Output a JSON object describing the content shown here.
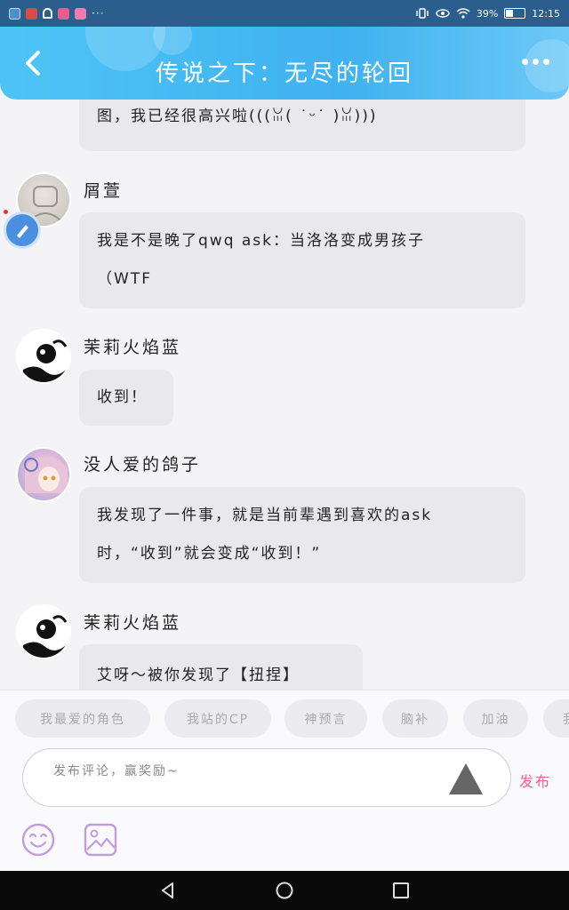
{
  "status_bar": {
    "battery_text": "39%",
    "battery_level": 0.39,
    "time": "12:15",
    "more_indicator": "···"
  },
  "header": {
    "title": "传说之下：无尽的轮回",
    "back_icon": "chevron-left-icon",
    "more_icon": "more-dots-icon"
  },
  "messages": [
    {
      "username": "",
      "text_lines": [
        "图，我已经很高兴啦(((ꈍ( ˙ᵕ˙ )ꈍ)))"
      ]
    },
    {
      "username": "屑萱",
      "text_lines": [
        "我是不是晚了qwq ask：当洛洛变成男孩子",
        "（WTF"
      ]
    },
    {
      "username": "茉莉火焰蓝",
      "text_lines": [
        "收到！"
      ]
    },
    {
      "username": "没人爱的鸽子",
      "text_lines": [
        "我发现了一件事，就是当前辈遇到喜欢的ask",
        "时，“收到”就会变成“收到！”"
      ]
    },
    {
      "username": "茉莉火焰蓝",
      "text_lines": [
        "艾呀～被你发现了【扭捏】"
      ]
    }
  ],
  "tags": [
    "我最爱的角色",
    "我站的CP",
    "神预言",
    "脑补",
    "加油",
    "我"
  ],
  "compose": {
    "placeholder": "发布评论，赢奖励~",
    "post_label": "发布",
    "send_icon": "triangle-up-icon",
    "emoji_icon": "smiley-icon",
    "image_icon": "image-icon"
  },
  "colors": {
    "header": "#4ec4f6",
    "accent_pink": "#f06292",
    "icon_lilac": "#c39be0",
    "bubble": "#e9e9ec"
  }
}
